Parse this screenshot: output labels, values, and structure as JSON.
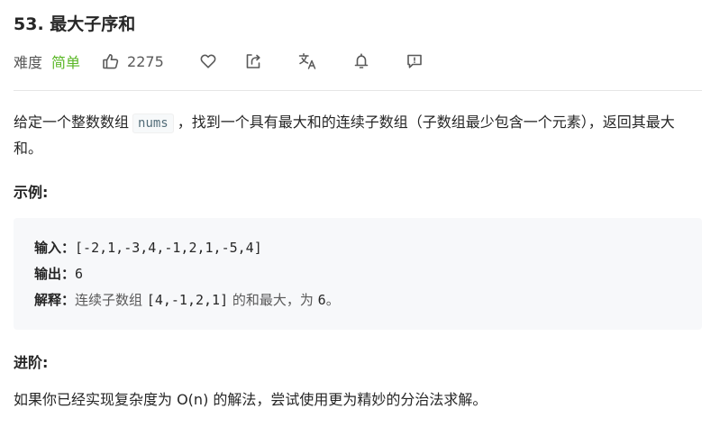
{
  "problem": {
    "title": "53. 最大子序和",
    "difficulty_label": "难度",
    "difficulty_value": "简单",
    "likes": "2275"
  },
  "icons": {
    "like": "thumbs-up-icon",
    "favorite": "heart-icon",
    "share": "share-icon",
    "translate": "translate-icon",
    "notify": "bell-icon",
    "feedback": "comment-icon"
  },
  "colors": {
    "difficulty_easy": "#5ab726",
    "text": "#262626",
    "muted": "#595959",
    "code_bg": "#f7f8fa"
  },
  "description": {
    "part1": "给定一个整数数组",
    "code": "nums",
    "part2": "，找到一个具有最大和的连续子数组（子数组最少包含一个元素），返回其最大和。"
  },
  "example": {
    "heading": "示例:",
    "input_label": "输入：",
    "input_value": "[-2,1,-3,4,-1,2,1,-5,4]",
    "output_label": "输出：",
    "output_value": "6",
    "explain_label": "解释：",
    "explain_part1": "连续子数组 ",
    "explain_code": "[4,-1,2,1]",
    "explain_part2": " 的和最大，为 ",
    "explain_value": "6",
    "explain_end": "。"
  },
  "advanced": {
    "heading": "进阶:",
    "text": "如果你已经实现复杂度为 O(n) 的解法，尝试使用更为精妙的分治法求解。"
  }
}
